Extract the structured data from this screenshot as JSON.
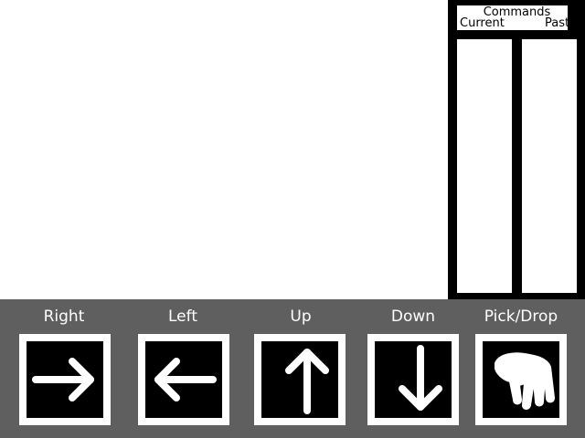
{
  "commands": {
    "title": "Commands",
    "current_label": "Current",
    "past_label": "Past",
    "current_items": [],
    "past_items": []
  },
  "controls": {
    "right_label": "Right",
    "left_label": "Left",
    "up_label": "Up",
    "down_label": "Down",
    "pick_drop_label": "Pick/Drop"
  },
  "icons": {
    "right": "arrow-right-icon",
    "left": "arrow-left-icon",
    "up": "arrow-up-icon",
    "down": "arrow-down-icon",
    "pick_drop": "hand-grab-icon"
  },
  "colors": {
    "panel": "#000000",
    "control_bar": "#5f5f5f",
    "button_frame": "#ffffff",
    "icon": "#ffffff"
  }
}
